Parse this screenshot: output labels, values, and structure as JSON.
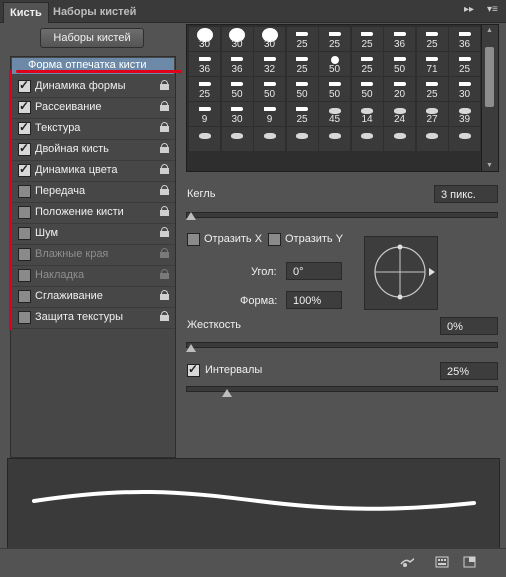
{
  "tabs": [
    {
      "label": "Кисть",
      "active": true
    },
    {
      "label": "Наборы кистей",
      "active": false
    }
  ],
  "presets_button": "Наборы кистей",
  "settings_list": [
    {
      "label": "Форма отпечатка кисти",
      "header": true
    },
    {
      "label": "Динамика формы",
      "checked": true,
      "enabled": true
    },
    {
      "label": "Рассеивание",
      "checked": true,
      "enabled": true
    },
    {
      "label": "Текстура",
      "checked": true,
      "enabled": true
    },
    {
      "label": "Двойная кисть",
      "checked": true,
      "enabled": true
    },
    {
      "label": "Динамика цвета",
      "checked": true,
      "enabled": true
    },
    {
      "label": "Передача",
      "checked": false,
      "enabled": true
    },
    {
      "label": "Положение кисти",
      "checked": false,
      "enabled": true
    },
    {
      "label": "Шум",
      "checked": false,
      "enabled": true
    },
    {
      "label": "Влажные края",
      "checked": false,
      "enabled": false
    },
    {
      "label": "Накладка",
      "checked": false,
      "enabled": false
    },
    {
      "label": "Сглаживание",
      "checked": false,
      "enabled": true
    },
    {
      "label": "Защита текстуры",
      "checked": false,
      "enabled": true
    }
  ],
  "brush_tips": [
    [
      "30",
      "30",
      "30",
      "25",
      "25",
      "25",
      "36",
      "25",
      "36"
    ],
    [
      "36",
      "36",
      "32",
      "25",
      "50",
      "25",
      "50",
      "71",
      "25"
    ],
    [
      "25",
      "50",
      "50",
      "50",
      "50",
      "50",
      "20",
      "25",
      "30"
    ],
    [
      "9",
      "30",
      "9",
      "25",
      "45",
      "14",
      "24",
      "27",
      "39"
    ],
    [
      "",
      "",
      "",
      "",
      "",
      "",
      "",
      "",
      ""
    ]
  ],
  "size": {
    "label": "Кегль",
    "value": "3 пикс.",
    "fraction": 0.0
  },
  "flip_x": {
    "label": "Отразить X",
    "checked": false
  },
  "flip_y": {
    "label": "Отразить Y",
    "checked": false
  },
  "angle": {
    "label": "Угол:",
    "value": "0°"
  },
  "roundness": {
    "label": "Форма:",
    "value": "100%"
  },
  "hardness": {
    "label": "Жесткость",
    "value": "0%",
    "fraction": 0.0
  },
  "spacing": {
    "label": "Интервалы",
    "value": "25%",
    "checked": true,
    "fraction": 0.12
  },
  "colors": {
    "accent": "#6c8aa8",
    "annotation": "#e0001b"
  }
}
